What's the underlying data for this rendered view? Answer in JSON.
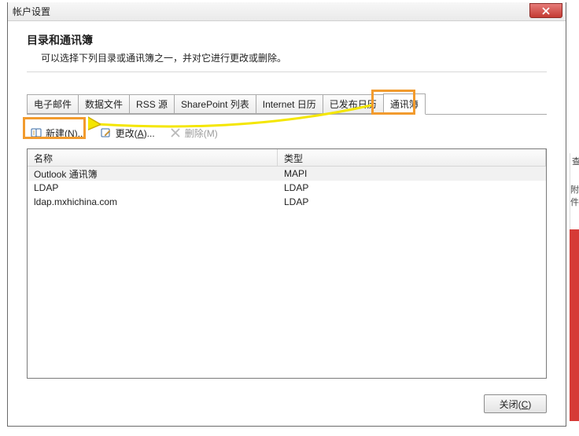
{
  "window": {
    "title": "帐户设置"
  },
  "header": {
    "title": "目录和通讯簿",
    "desc": "可以选择下列目录或通讯簿之一，并对它进行更改或删除。"
  },
  "tabs": [
    {
      "label": "电子邮件"
    },
    {
      "label": "数据文件"
    },
    {
      "label": "RSS 源"
    },
    {
      "label": "SharePoint 列表"
    },
    {
      "label": "Internet 日历"
    },
    {
      "label": "已发布日历"
    },
    {
      "label": "通讯簿"
    }
  ],
  "toolbar": {
    "new_prefix": "新建(",
    "new_key": "N",
    "new_suffix": ")...",
    "modify_prefix": "更改(",
    "modify_key": "A",
    "modify_suffix": ")...",
    "delete_prefix": "删除(",
    "delete_key": "M",
    "delete_suffix": ")"
  },
  "columns": {
    "name": "名称",
    "type": "类型"
  },
  "rows": [
    {
      "name": "Outlook 通讯簿",
      "type": "MAPI",
      "selected": true
    },
    {
      "name": "LDAP",
      "type": "LDAP",
      "selected": false
    },
    {
      "name": "ldap.mxhichina.com",
      "type": "LDAP",
      "selected": false
    }
  ],
  "buttons": {
    "close_prefix": "关闭(",
    "close_key": "C",
    "close_suffix": ")"
  },
  "highlight_color": "#f29b2e",
  "arrow_color": "#f4e600",
  "right_context": {
    "frag1": "查",
    "frag2": "附件"
  }
}
